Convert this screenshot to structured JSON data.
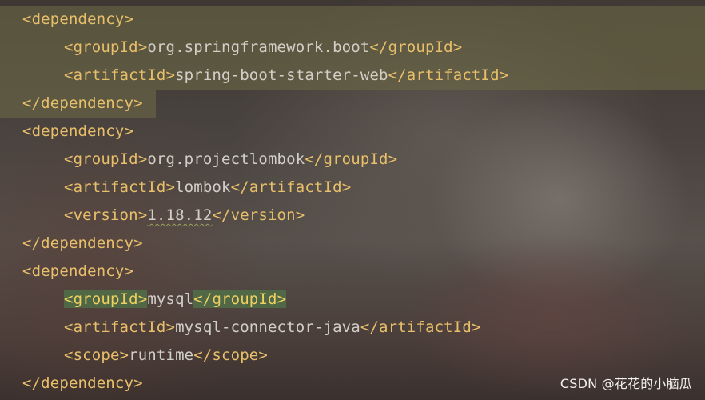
{
  "editor": {
    "lines": [
      {
        "indent": 0,
        "tag_open": "<dependency>",
        "value": "",
        "tag_close": ""
      },
      {
        "indent": 1,
        "tag_open": "<groupId>",
        "value": "org.springframework.boot",
        "tag_close": "</groupId>"
      },
      {
        "indent": 1,
        "tag_open": "<artifactId>",
        "value": "spring-boot-starter-web",
        "tag_close": "</artifactId>"
      },
      {
        "indent": 0,
        "tag_open": "</dependency>",
        "value": "",
        "tag_close": ""
      },
      {
        "indent": 0,
        "tag_open": "<dependency>",
        "value": "",
        "tag_close": ""
      },
      {
        "indent": 1,
        "tag_open": "<groupId>",
        "value": "org.projectlombok",
        "tag_close": "</groupId>"
      },
      {
        "indent": 1,
        "tag_open": "<artifactId>",
        "value": "lombok",
        "tag_close": "</artifactId>"
      },
      {
        "indent": 1,
        "tag_open": "<version>",
        "value": "1.18.12",
        "tag_close": "</version>"
      },
      {
        "indent": 0,
        "tag_open": "</dependency>",
        "value": "",
        "tag_close": ""
      },
      {
        "indent": 0,
        "tag_open": "<dependency>",
        "value": "",
        "tag_close": ""
      },
      {
        "indent": 1,
        "tag_open": "<groupId>",
        "value": "mysql",
        "tag_close": "</groupId>"
      },
      {
        "indent": 1,
        "tag_open": "<artifactId>",
        "value": "mysql-connector-java",
        "tag_close": "</artifactId>"
      },
      {
        "indent": 1,
        "tag_open": "<scope>",
        "value": "runtime",
        "tag_close": "</scope>"
      },
      {
        "indent": 0,
        "tag_open": "</dependency>",
        "value": "",
        "tag_close": ""
      }
    ]
  },
  "watermark": "CSDN @花花的小脑瓜",
  "colors": {
    "tag": "#e8bf6a",
    "text": "#d2cfc8",
    "highlight": "#706c46",
    "brace_match": "#506e46"
  }
}
